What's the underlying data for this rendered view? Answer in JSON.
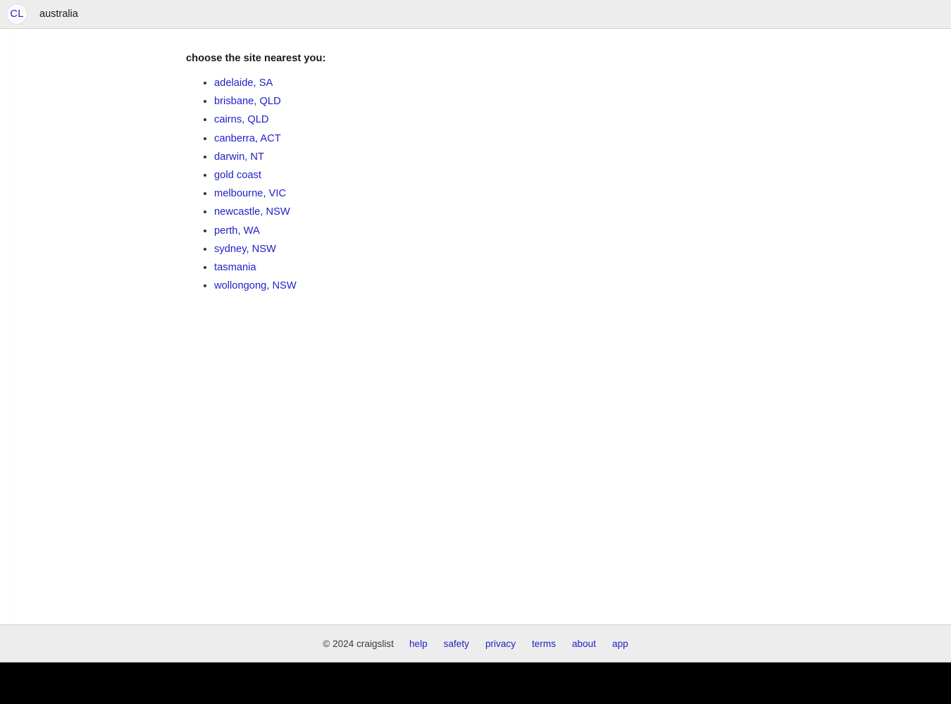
{
  "header": {
    "logo_text": "CL",
    "site_name": "australia"
  },
  "main": {
    "heading": "choose the site nearest you:",
    "cities": [
      "adelaide, SA",
      "brisbane, QLD",
      "cairns, QLD",
      "canberra, ACT",
      "darwin, NT",
      "gold coast",
      "melbourne, VIC",
      "newcastle, NSW",
      "perth, WA",
      "sydney, NSW",
      "tasmania",
      "wollongong, NSW"
    ]
  },
  "footer": {
    "copyright": "© 2024 craigslist",
    "links": [
      "help",
      "safety",
      "privacy",
      "terms",
      "about",
      "app"
    ]
  },
  "colors": {
    "link": "#1f1fc8",
    "logo": "#2222cc",
    "chrome": "#ededed",
    "text": "#1a1a1a"
  }
}
